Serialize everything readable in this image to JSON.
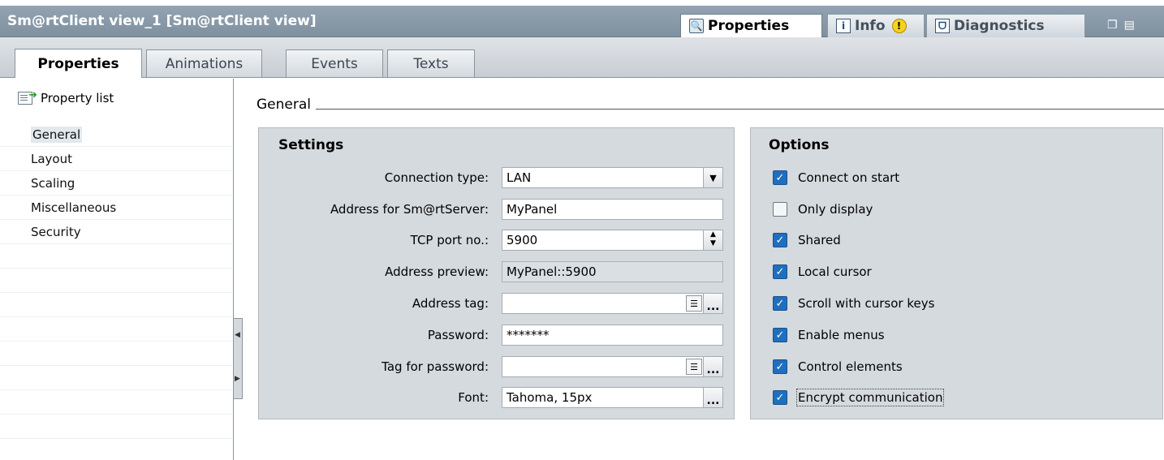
{
  "window": {
    "title": "Sm@rtClient view_1 [Sm@rtClient view]",
    "tabs": [
      {
        "label": "Properties",
        "icon": "properties-icon",
        "active": true
      },
      {
        "label": "Info",
        "icon": "info-icon",
        "active": false,
        "badge_icon": "warning-icon"
      },
      {
        "label": "Diagnostics",
        "icon": "diagnostics-icon",
        "active": false
      }
    ]
  },
  "subtabs": [
    {
      "label": "Properties",
      "active": true
    },
    {
      "label": "Animations",
      "active": false
    },
    {
      "label": "Events",
      "active": false
    },
    {
      "label": "Texts",
      "active": false
    }
  ],
  "left_panel": {
    "header": "Property list",
    "items": [
      {
        "label": "General",
        "selected": true
      },
      {
        "label": "Layout",
        "selected": false
      },
      {
        "label": "Scaling",
        "selected": false
      },
      {
        "label": "Miscellaneous",
        "selected": false
      },
      {
        "label": "Security",
        "selected": false
      }
    ]
  },
  "content": {
    "section_title": "General",
    "settings": {
      "title": "Settings",
      "fields": {
        "connection_type": {
          "label": "Connection type:",
          "value": "LAN"
        },
        "address_server": {
          "label": "Address for Sm@rtServer:",
          "value": "MyPanel"
        },
        "tcp_port": {
          "label": "TCP port no.:",
          "value": "5900"
        },
        "address_preview": {
          "label": "Address preview:",
          "value": "MyPanel::5900"
        },
        "address_tag": {
          "label": "Address tag:",
          "value": ""
        },
        "password": {
          "label": "Password:",
          "value": "*******"
        },
        "tag_password": {
          "label": "Tag for password:",
          "value": ""
        },
        "font": {
          "label": "Font:",
          "value": "Tahoma, 15px"
        }
      }
    },
    "options": {
      "title": "Options",
      "items": [
        {
          "label": "Connect on start",
          "checked": true
        },
        {
          "label": "Only display",
          "checked": false
        },
        {
          "label": "Shared",
          "checked": true
        },
        {
          "label": "Local cursor",
          "checked": true
        },
        {
          "label": "Scroll with cursor keys",
          "checked": true
        },
        {
          "label": "Enable menus",
          "checked": true
        },
        {
          "label": "Control elements",
          "checked": true
        },
        {
          "label": "Encrypt communication",
          "checked": true
        }
      ]
    }
  },
  "colors": {
    "titlebar": "#8b9bab",
    "panel": "#d5dade",
    "checkbox": "#1f6fbf"
  }
}
